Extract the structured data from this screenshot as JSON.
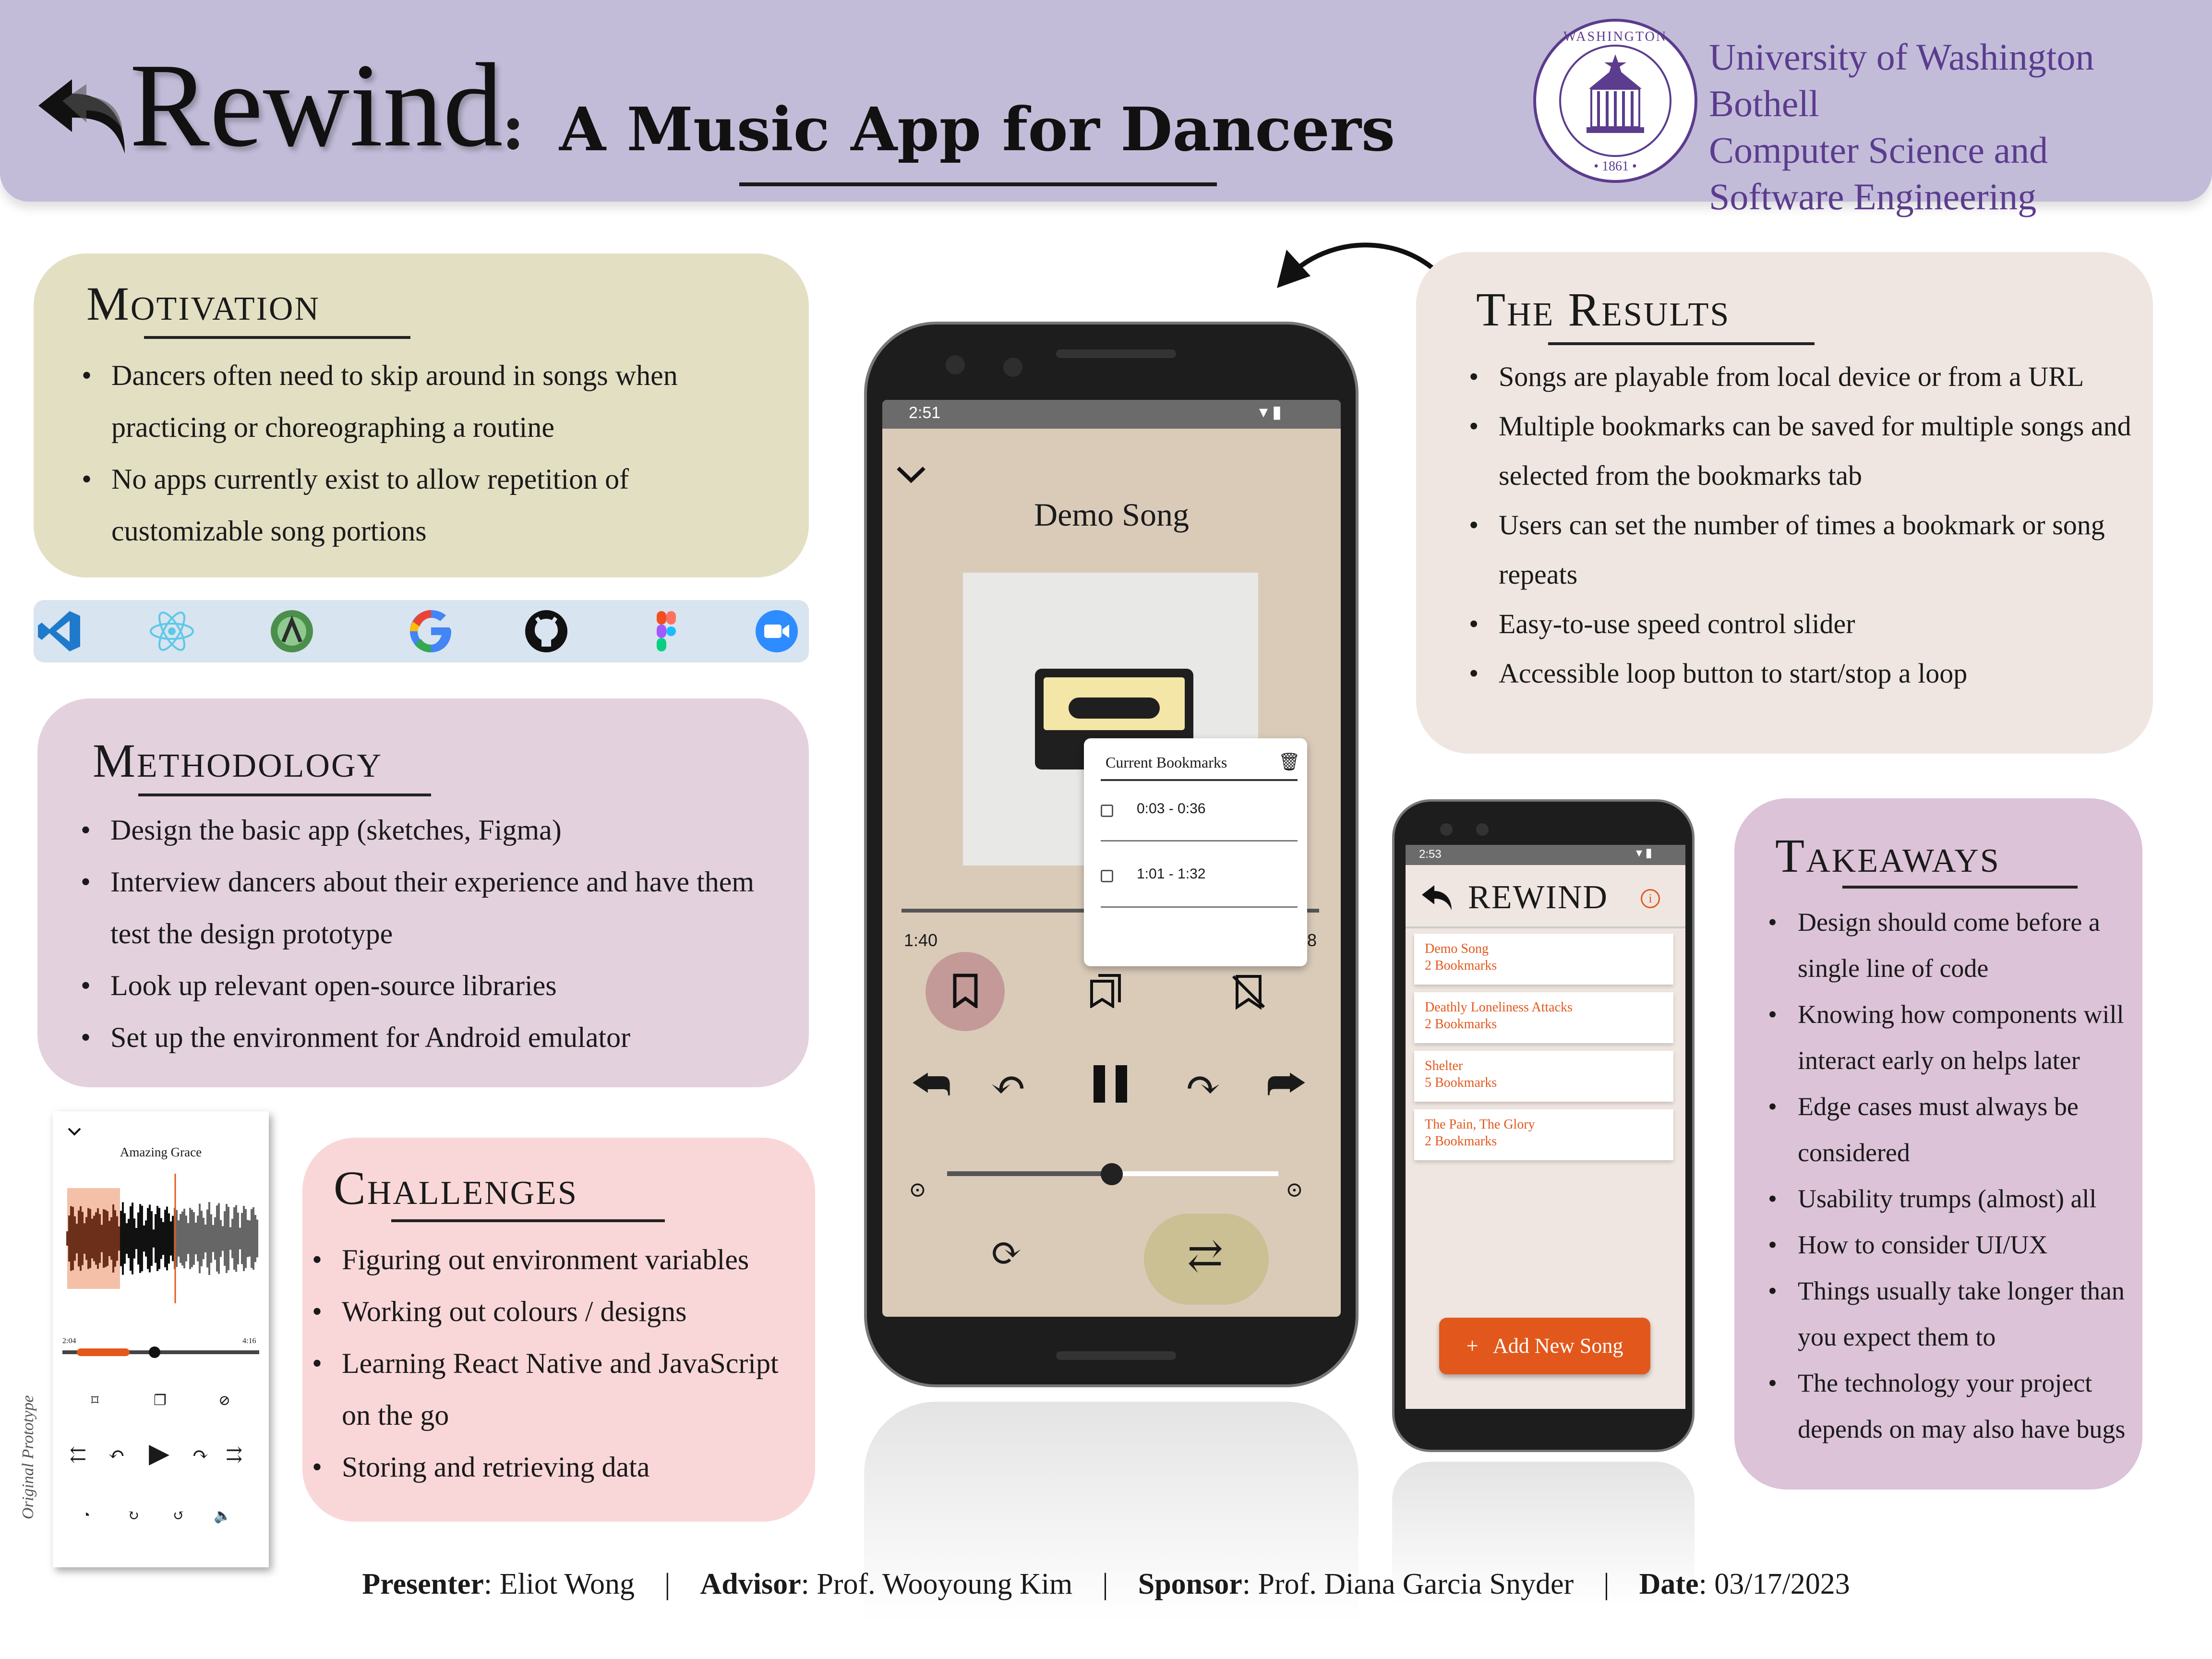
{
  "header": {
    "title": "Rewind",
    "colon": ":",
    "subtitle": "A Music App for Dancers",
    "university": [
      "University of Washington Bothell",
      "Computer Science and",
      "Software Engineering"
    ],
    "seal_text": "UNIVERSITY OF WASHINGTON 1861 LVX SIT"
  },
  "motivation": {
    "title": "Motivation",
    "bullets": [
      "Dancers often need to skip around in songs when practicing or choreographing a routine",
      "No apps currently exist to allow repetition of customizable song portions"
    ]
  },
  "tools": {
    "icons": [
      "vscode-icon",
      "react-icon",
      "android-studio-icon",
      "google-icon",
      "github-icon",
      "figma-icon",
      "zoom-icon"
    ]
  },
  "methodology": {
    "title": "Methodology",
    "bullets": [
      "Design the basic app (sketches, Figma)",
      "Interview dancers about their experience and have them test the design prototype",
      "Look up relevant open-source libraries",
      "Set up the environment for Android emulator"
    ]
  },
  "challenges": {
    "title": "Challenges",
    "bullets": [
      "Figuring out environment variables",
      "Working out colours / designs",
      "Learning React Native and JavaScript on the go",
      "Storing and retrieving data"
    ]
  },
  "results": {
    "title": "The Results",
    "bullets": [
      "Songs are playable from local device or from a URL",
      "Multiple bookmarks can be saved for multiple songs and selected from the bookmarks tab",
      "Users can set the number of times a bookmark or song repeats",
      "Easy-to-use speed control slider",
      "Accessible loop button to start/stop a loop"
    ]
  },
  "takeaways": {
    "title": "Takeaways",
    "bullets": [
      "Design should come before a single line of code",
      "Knowing how components will interact early on helps later",
      "Edge cases must always be considered",
      "Usability trumps (almost) all",
      "How to consider UI/UX",
      "Things usually take longer than you expect them to",
      "The technology your project depends on may also have bugs"
    ]
  },
  "phone1": {
    "status_time": "2:51",
    "song_title": "Demo Song",
    "elapsed": "1:40",
    "duration_tail": "8",
    "bookmarks_popup": {
      "title": "Current Bookmarks",
      "items": [
        "0:03 - 0:36",
        "1:01 - 1:32"
      ]
    }
  },
  "phone2": {
    "status_time": "2:53",
    "app_title": "REWIND",
    "songs": [
      {
        "name": "Demo Song",
        "count": "2 Bookmarks"
      },
      {
        "name": "Deathly Loneliness Attacks",
        "count": "2 Bookmarks"
      },
      {
        "name": "Shelter",
        "count": "5 Bookmarks"
      },
      {
        "name": "The Pain, The Glory",
        "count": "2 Bookmarks"
      }
    ],
    "add_button": "+   Add New Song"
  },
  "prototype": {
    "song_title": "Amazing Grace",
    "time_start": "2:04",
    "time_end": "4:16",
    "caption": "Original Prototype"
  },
  "footer": {
    "presenter_label": "Presenter",
    "presenter": ": Eliot Wong",
    "advisor_label": "Advisor",
    "advisor": ": Prof. Wooyoung Kim",
    "sponsor_label": "Sponsor",
    "sponsor": ": Prof. Diana Garcia Snyder",
    "date_label": "Date",
    "date": ": 03/17/2023",
    "separator": "|"
  },
  "colors": {
    "header": "#c3bcd9",
    "motivation": "#e3dfc3",
    "methodology": "#e4d1de",
    "challenges": "#f9d7d8",
    "results": "#efe6e1",
    "takeaways": "#dcc3d8",
    "accent_orange": "#e2581c"
  }
}
